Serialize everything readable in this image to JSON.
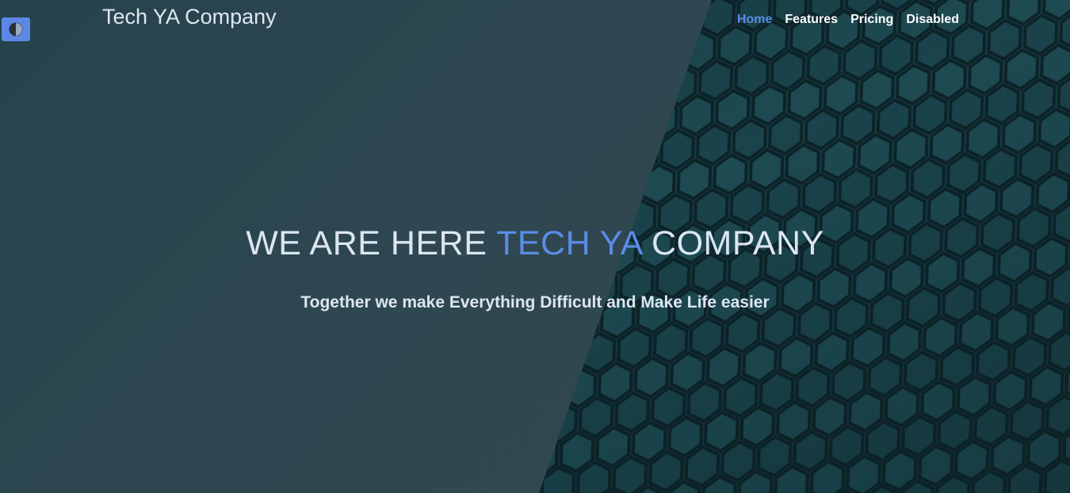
{
  "header": {
    "brand": "Tech YA Company",
    "nav": [
      {
        "label": "Home",
        "active": true
      },
      {
        "label": "Features",
        "active": false
      },
      {
        "label": "Pricing",
        "active": false
      },
      {
        "label": "Disabled",
        "active": false
      }
    ]
  },
  "theme_toggle": {
    "icon": "half-moon-icon"
  },
  "hero": {
    "headline_start": "WE ARE HERE ",
    "headline_accent": "TECH YA",
    "headline_end": " COMPANY",
    "tagline": "Together we make Everything Difficult and Make Life easier"
  },
  "colors": {
    "accent": "#5b8ce6",
    "text": "#dce6f2",
    "background": "#2f4750"
  }
}
